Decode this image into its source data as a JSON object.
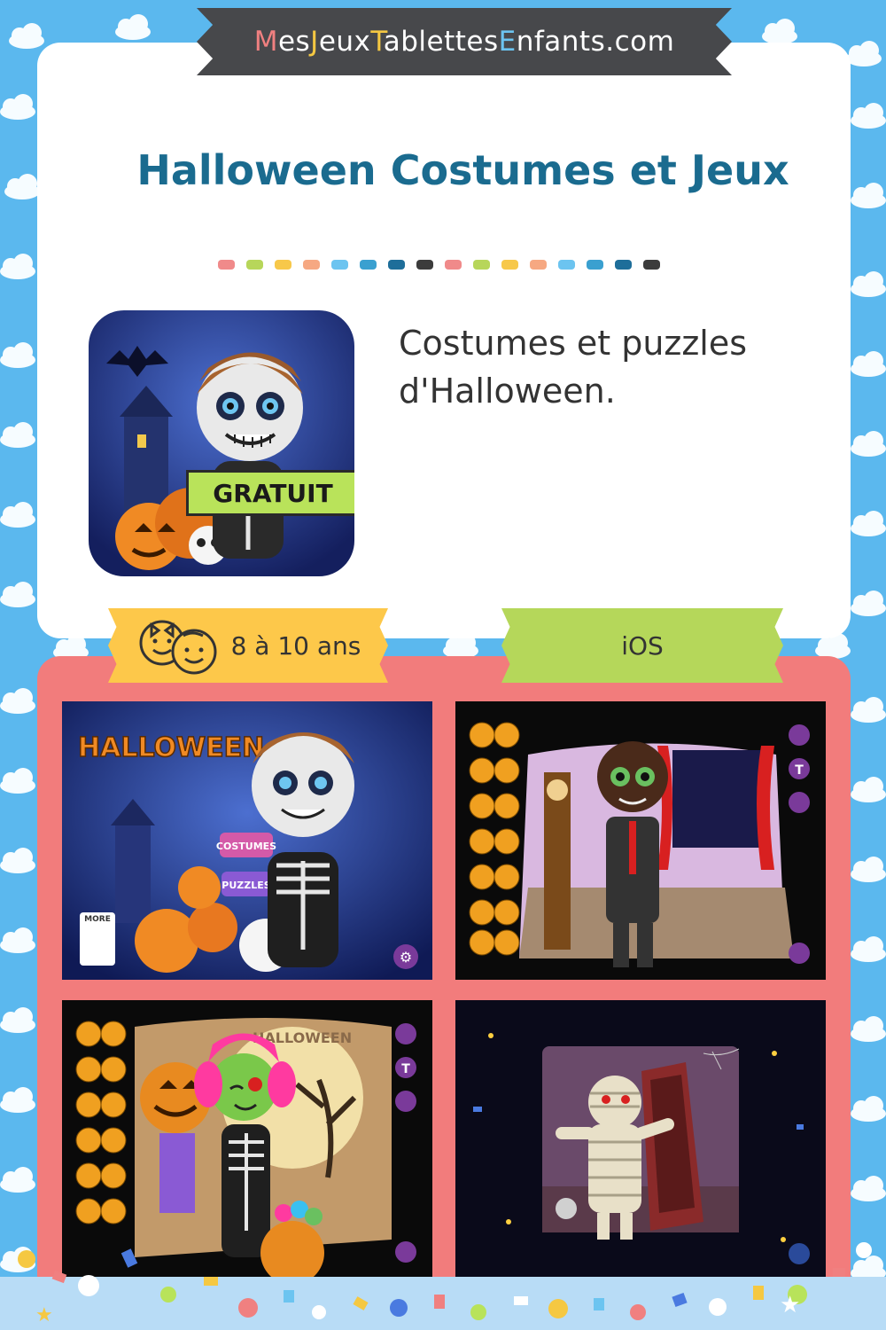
{
  "banner": {
    "segments": [
      {
        "text": "M",
        "color": "red"
      },
      {
        "text": "es",
        "color": "w"
      },
      {
        "text": "J",
        "color": "yel"
      },
      {
        "text": "eux",
        "color": "w"
      },
      {
        "text": "T",
        "color": "yel"
      },
      {
        "text": "ablettes",
        "color": "w"
      },
      {
        "text": "E",
        "color": "blu"
      },
      {
        "text": "nfants.com",
        "color": "w"
      }
    ]
  },
  "title": "Halloween Costumes et Jeux",
  "icon_badge": "GRATUIT",
  "description": "Costumes et puzzles d'Halloween.",
  "age_tag": "8 à 10 ans",
  "platform_tag": "iOS",
  "screenshot1": {
    "logo": "HALLOWEEN",
    "buttons": [
      "COSTUMES",
      "PUZZLES"
    ],
    "more_label": "MORE"
  },
  "screenshot3": {
    "sign": "HALLOWEEN"
  },
  "colors": {
    "background": "#5bb8ee",
    "title": "#1a6b8f",
    "banner": "#47484b",
    "panel": "#f27c7c",
    "age_tag": "#fdc84a",
    "platform_tag": "#b5d75a",
    "gratuit": "#b9e35a"
  },
  "divider_colors": [
    "#f08a8a",
    "#b7d65a",
    "#f7c84a",
    "#f6a882",
    "#6cc4f0",
    "#3aa0d0",
    "#1e6e9a",
    "#3c3c3c",
    "#f08a8a",
    "#b7d65a",
    "#f7c84a",
    "#f6a882",
    "#6cc4f0",
    "#3aa0d0",
    "#1e6e9a",
    "#3c3c3c"
  ]
}
